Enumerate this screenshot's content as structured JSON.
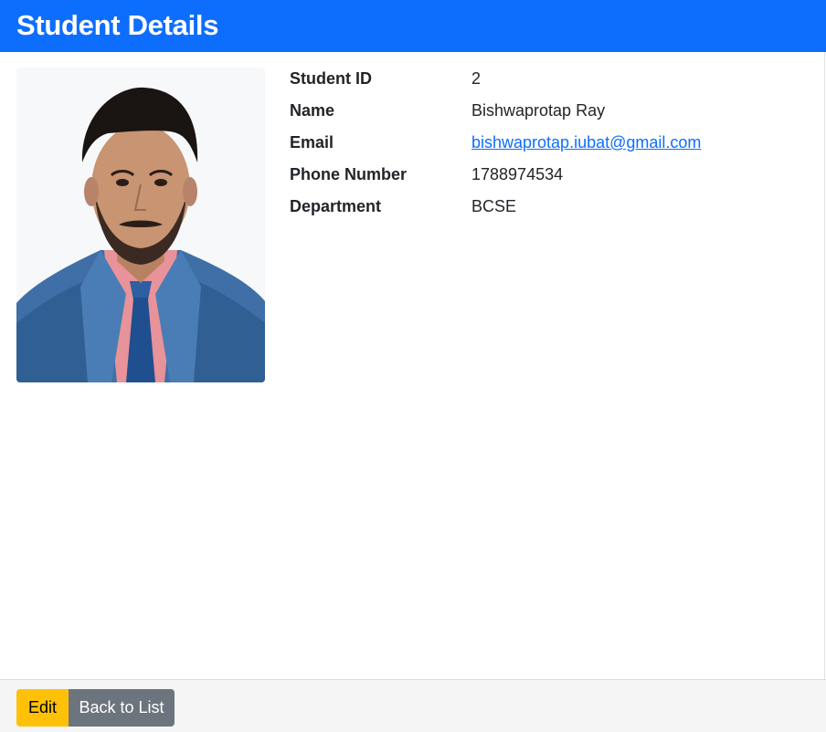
{
  "header": {
    "title": "Student Details",
    "background": "#0d6efd"
  },
  "photo": {
    "icon": "student-photo"
  },
  "details": [
    {
      "label": "Student ID",
      "value": "2"
    },
    {
      "label": "Name",
      "value": "Bishwaprotap Ray"
    },
    {
      "label": "Email",
      "value": "bishwaprotap.iubat@gmail.com"
    },
    {
      "label": "Phone Number",
      "value": "1788974534"
    },
    {
      "label": "Department",
      "value": "BCSE"
    }
  ],
  "footer": {
    "edit_label": "Edit",
    "back_label": "Back to List",
    "edit_color": "#ffc107",
    "back_color": "#6c757d"
  }
}
